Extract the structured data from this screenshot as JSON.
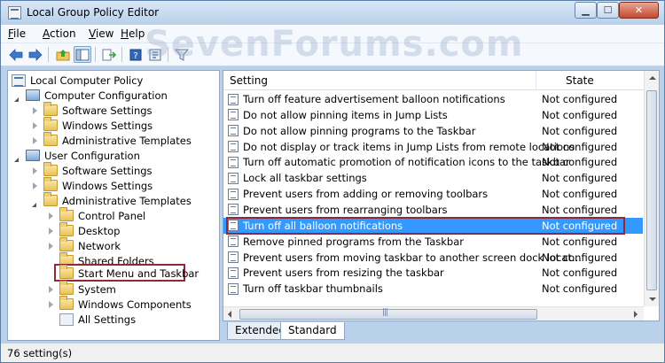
{
  "window": {
    "title": "Local Group Policy Editor",
    "watermark": "SevenForums.com",
    "controls": {
      "minimize": "▁",
      "maximize": "☐",
      "close": "✕"
    }
  },
  "menu": [
    {
      "label": "File",
      "key": "F"
    },
    {
      "label": "Action",
      "key": "A"
    },
    {
      "label": "View",
      "key": "V"
    },
    {
      "label": "Help",
      "key": "H"
    }
  ],
  "toolbar": {
    "icons": [
      "back-arrow-icon",
      "forward-arrow-icon",
      "up-folder-icon",
      "show-hide-tree-icon",
      "export-list-icon",
      "help-icon",
      "properties-icon",
      "filter-icon"
    ]
  },
  "tree": {
    "root": "Local Computer Policy",
    "computer_config": "Computer Configuration",
    "cc_children": [
      "Software Settings",
      "Windows Settings",
      "Administrative Templates"
    ],
    "user_config": "User Configuration",
    "uc_children": [
      "Software Settings",
      "Windows Settings",
      "Administrative Templates"
    ],
    "at_children": [
      "Control Panel",
      "Desktop",
      "Network",
      "Shared Folders",
      "Start Menu and Taskbar",
      "System",
      "Windows Components",
      "All Settings"
    ]
  },
  "list": {
    "columns": {
      "setting": "Setting",
      "state": "State"
    },
    "rows": [
      {
        "setting": "Turn off feature advertisement balloon notifications",
        "state": "Not configured"
      },
      {
        "setting": "Do not allow pinning items in Jump Lists",
        "state": "Not configured"
      },
      {
        "setting": "Do not allow pinning programs to the Taskbar",
        "state": "Not configured"
      },
      {
        "setting": "Do not display or track items in Jump Lists from remote locations",
        "state": "Not configured"
      },
      {
        "setting": "Turn off automatic promotion of notification icons to the taskbar",
        "state": "Not configured"
      },
      {
        "setting": "Lock all taskbar settings",
        "state": "Not configured"
      },
      {
        "setting": "Prevent users from adding or removing toolbars",
        "state": "Not configured"
      },
      {
        "setting": "Prevent users from rearranging toolbars",
        "state": "Not configured"
      },
      {
        "setting": "Turn off all balloon notifications",
        "state": "Not configured",
        "selected": true
      },
      {
        "setting": "Remove pinned programs from the Taskbar",
        "state": "Not configured"
      },
      {
        "setting": "Prevent users from moving taskbar to another screen dock locat...",
        "state": "Not configured"
      },
      {
        "setting": "Prevent users from resizing the taskbar",
        "state": "Not configured"
      },
      {
        "setting": "Turn off taskbar thumbnails",
        "state": "Not configured"
      }
    ]
  },
  "tabs": [
    {
      "label": "Extended",
      "active": false
    },
    {
      "label": "Standard",
      "active": true
    }
  ],
  "status": "76 setting(s)",
  "colors": {
    "selection": "#3399ff",
    "highlight_box": "#8c2a3b"
  }
}
